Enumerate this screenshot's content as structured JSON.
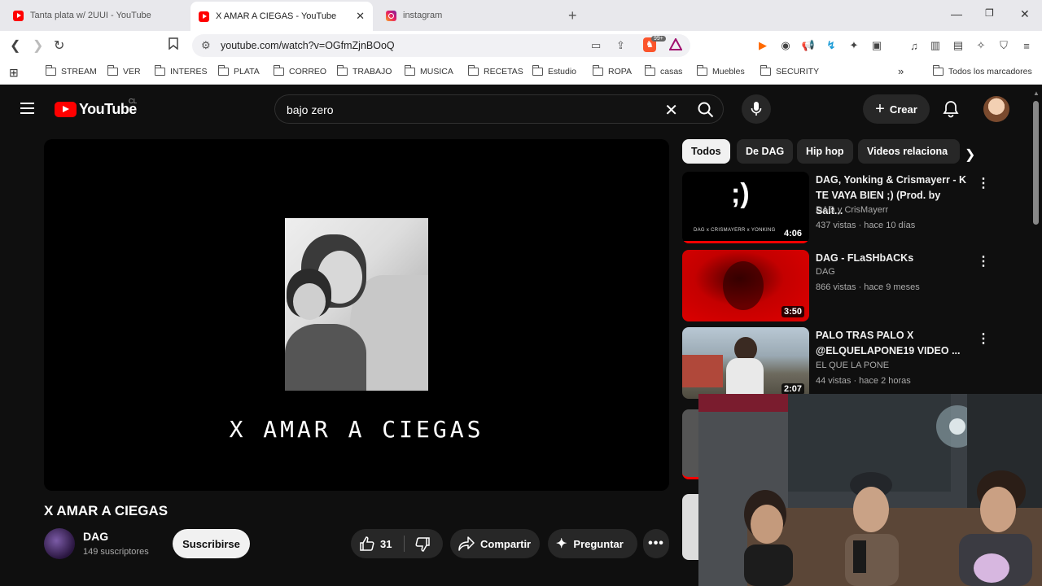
{
  "browser": {
    "tabs": [
      {
        "title": "Tanta plata w/ 2UUI - YouTube",
        "icon": "youtube-icon"
      },
      {
        "title": "X AMAR A CIEGAS - YouTube",
        "icon": "youtube-icon",
        "active": true
      },
      {
        "title": "instagram",
        "icon": "instagram-icon"
      }
    ],
    "url": "youtube.com/watch?v=OGfmZjnBOoQ",
    "extension_badge": "99+",
    "bookmarks": [
      "STREAM",
      "VER",
      "INTERES",
      "PLATA",
      "CORREO",
      "TRABAJO",
      "MUSICA",
      "RECETAS",
      "Estudio",
      "ROPA",
      "casas",
      "Muebles",
      "SECURITY"
    ],
    "all_bookmarks": "Todos los marcadores"
  },
  "youtube": {
    "logo_text": "YouTube",
    "country": "CL",
    "search_query": "bajo zero",
    "create_label": "Crear",
    "video": {
      "overlay_text": "X AMAR A CIEGAS",
      "title": "X AMAR A CIEGAS",
      "channel": "DAG",
      "subscribers": "149 suscriptores",
      "subscribe_label": "Suscribirse",
      "likes": "31",
      "share_label": "Compartir",
      "ask_label": "Preguntar"
    },
    "chips": [
      "Todos",
      "De DAG",
      "Hip hop",
      "Videos relaciona"
    ],
    "recommendations": [
      {
        "title": "DAG, Yonking & Crismayerr - K TE VAYA BIEN ;) (Prod. by Sait...",
        "channel": "DAG y CrisMayerr",
        "meta": "437 vistas · hace 10 días",
        "duration": "4:06",
        "thumb_text": ";)",
        "thumb_caption": "DAG x CRISMAYERR x YONKING"
      },
      {
        "title": "DAG - FLaSHbACKs",
        "channel": "DAG",
        "meta": "866 vistas · hace 9 meses",
        "duration": "3:50"
      },
      {
        "title": "PALO TRAS PALO X @ELQUELAPONE19 VIDEO ...",
        "channel": "EL QUE LA PONE",
        "meta": "44 vistas · hace 2 horas",
        "duration": "2:07"
      }
    ]
  },
  "colors": {
    "brand_red": "#ff0000",
    "bg": "#0f0f0f",
    "chip": "#272727"
  }
}
